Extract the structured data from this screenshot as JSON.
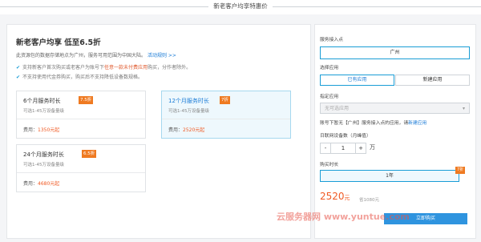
{
  "header": {
    "title": "新老客户均享特惠价"
  },
  "promo": {
    "heading": "新老客户均享 低至6.5折",
    "notice": "此资源包的数据存储地点为广州，服务可用范围为中国大陆。",
    "rules_link": "活动规则 >>",
    "bullet1_pre": "支持新客户首次购买或老客户为账号下",
    "bullet1_highlight": "任意一款未付费应用",
    "bullet1_post": "购买，分作者除外。",
    "bullet2": "不支持使用代金券购买，购买后不支持降低设备数规格。"
  },
  "plans": [
    {
      "name": "6个月服务时长",
      "discount": "7.5折",
      "range": "可选1-45万设备量级",
      "fee_label": "费用：",
      "price": "1350元起"
    },
    {
      "name": "12个月服务时长",
      "discount": "7折",
      "range": "可选1-45万设备量级",
      "fee_label": "费用：",
      "price": "2520元起"
    },
    {
      "name": "24个月服务时长",
      "discount": "6.5折",
      "range": "可选1-45万设备量级",
      "fee_label": "费用：",
      "price": "4680元起"
    }
  ],
  "panel": {
    "region_label": "服务接入点",
    "region_value": "广州",
    "app_label": "选择应用",
    "app_options": [
      "已有应用",
      "新建应用"
    ],
    "select_label": "指定应用",
    "select_placeholder": "无可选应用",
    "account_note": "账号下暂无【广州】服务接入点的应用，请",
    "create_link": "新建应用",
    "device_label": "日联网设备数（月峰值）",
    "minus": "-",
    "quantity": "1",
    "plus": "+",
    "unit": "万",
    "duration_label": "购买时长",
    "duration_value": "1年",
    "duration_discount": "7折",
    "price": "2520",
    "price_unit": "元",
    "original_price": "省1080元",
    "buy_button": "立即购买"
  },
  "watermark": "云服务器网 www.yuntue.com",
  "colors": {
    "accent": "#1a9dd6",
    "price": "#f05a24",
    "tag": "#ef7a21"
  }
}
